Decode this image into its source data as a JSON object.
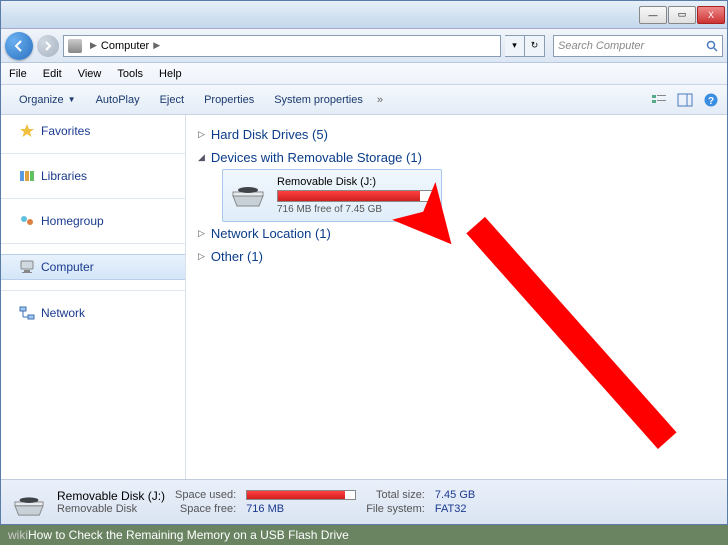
{
  "titlebar": {
    "min": "—",
    "max": "▭",
    "close": "X"
  },
  "address": {
    "crumb_root": "",
    "crumb_current": "Computer",
    "refresh_icon": "↻"
  },
  "search": {
    "placeholder": "Search Computer"
  },
  "menubar": {
    "items": [
      "File",
      "Edit",
      "View",
      "Tools",
      "Help"
    ]
  },
  "toolbar": {
    "organize": "Organize",
    "autoplay": "AutoPlay",
    "eject": "Eject",
    "properties": "Properties",
    "system_properties": "System properties",
    "overflow": "»"
  },
  "sidebar": {
    "favorites": "Favorites",
    "libraries": "Libraries",
    "homegroup": "Homegroup",
    "computer": "Computer",
    "network": "Network"
  },
  "content": {
    "groups": {
      "hdd": {
        "label": "Hard Disk Drives (5)",
        "expanded": false
      },
      "removable": {
        "label": "Devices with Removable Storage (1)",
        "expanded": true
      },
      "network": {
        "label": "Network Location (1)",
        "expanded": false
      },
      "other": {
        "label": "Other (1)",
        "expanded": false
      }
    },
    "drive": {
      "name": "Removable Disk (J:)",
      "space_text": "716 MB free of 7.45 GB",
      "used_percent": 91
    }
  },
  "statusbar": {
    "title": "Removable Disk (J:)",
    "subtitle": "Removable Disk",
    "labels": {
      "space_used": "Space used:",
      "space_free": "Space free:",
      "total_size": "Total size:",
      "file_system": "File system:"
    },
    "values": {
      "space_free": "716 MB",
      "total_size": "7.45 GB",
      "file_system": "FAT32"
    }
  },
  "caption": {
    "prefix": "wiki",
    "text": "How to Check the Remaining Memory on a USB Flash Drive"
  }
}
